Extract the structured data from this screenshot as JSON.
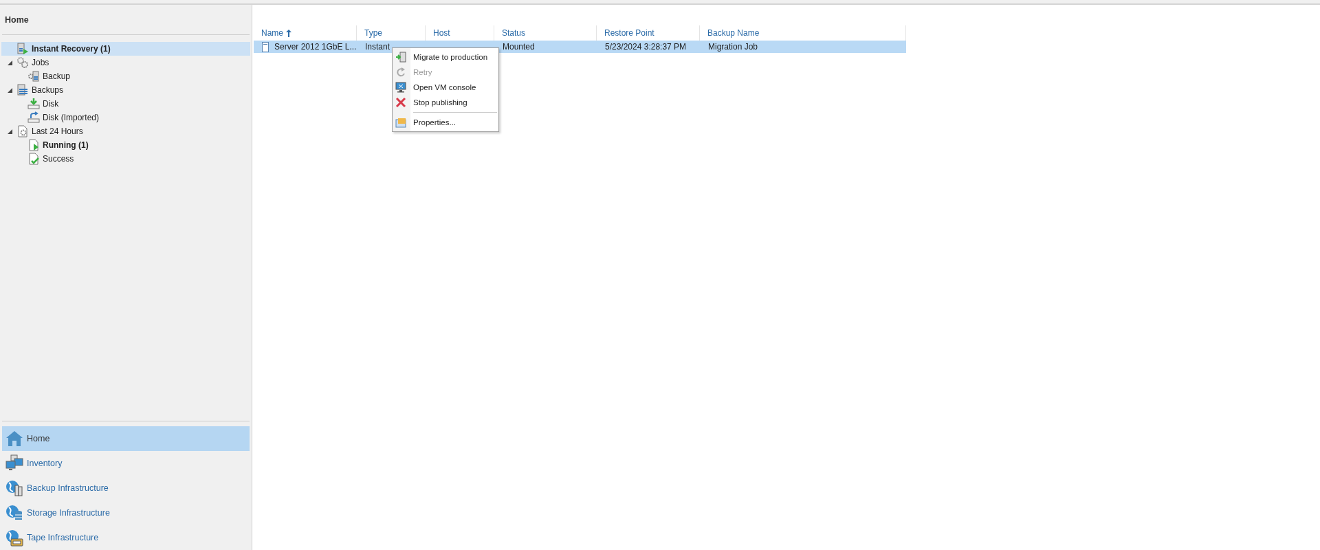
{
  "sidebar": {
    "title": "Home",
    "tree": [
      {
        "label": "Instant Recovery (1)",
        "kind": "recovery",
        "bold": true,
        "selected": true
      },
      {
        "label": "Jobs",
        "kind": "jobs",
        "bold": false,
        "selected": false,
        "expanded": true,
        "children": [
          {
            "label": "Backup",
            "kind": "backupjob",
            "bold": false,
            "selected": false
          }
        ]
      },
      {
        "label": "Backups",
        "kind": "backups",
        "bold": false,
        "selected": false,
        "expanded": true,
        "children": [
          {
            "label": "Disk",
            "kind": "disk",
            "bold": false,
            "selected": false
          },
          {
            "label": "Disk (Imported)",
            "kind": "imported",
            "bold": false,
            "selected": false
          }
        ]
      },
      {
        "label": "Last 24 Hours",
        "kind": "last24",
        "bold": false,
        "selected": false,
        "expanded": true,
        "children": [
          {
            "label": "Running (1)",
            "kind": "running",
            "bold": true,
            "selected": false
          },
          {
            "label": "Success",
            "kind": "success",
            "bold": false,
            "selected": false
          }
        ]
      }
    ],
    "nav": [
      {
        "label": "Home",
        "kind": "home",
        "selected": true
      },
      {
        "label": "Inventory",
        "kind": "inventory",
        "selected": false
      },
      {
        "label": "Backup Infrastructure",
        "kind": "backupinfra",
        "selected": false
      },
      {
        "label": "Storage Infrastructure",
        "kind": "storage",
        "selected": false
      },
      {
        "label": "Tape Infrastructure",
        "kind": "tape",
        "selected": false
      }
    ]
  },
  "table": {
    "columns": [
      {
        "label": "Name",
        "sorted": true
      },
      {
        "label": "Type",
        "sorted": false
      },
      {
        "label": "Host",
        "sorted": false
      },
      {
        "label": "Status",
        "sorted": false
      },
      {
        "label": "Restore Point",
        "sorted": false
      },
      {
        "label": "Backup Name",
        "sorted": false
      }
    ],
    "rows": [
      {
        "selected": true,
        "cells": [
          "Server 2012 1GbE L...",
          "Instant",
          "",
          "Mounted",
          "5/23/2024 3:28:37 PM",
          "Migration Job"
        ]
      }
    ]
  },
  "context_menu": {
    "items": [
      {
        "label": "Migrate to production",
        "kind": "migrate",
        "disabled": false
      },
      {
        "label": "Retry",
        "kind": "retry",
        "disabled": true
      },
      {
        "label": "Open VM console",
        "kind": "console",
        "disabled": false
      },
      {
        "label": "Stop publishing",
        "kind": "stop",
        "disabled": false
      },
      {
        "label": "Properties...",
        "kind": "properties",
        "disabled": false,
        "separator_before": true
      }
    ]
  }
}
